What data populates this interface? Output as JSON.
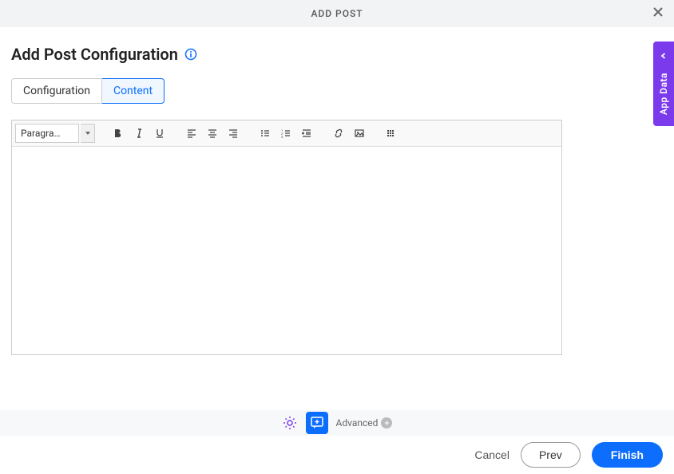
{
  "modal": {
    "title": "ADD POST"
  },
  "page": {
    "heading": "Add Post Configuration"
  },
  "tabs": {
    "configuration": "Configuration",
    "content": "Content"
  },
  "editor": {
    "format_label": "Paragra…"
  },
  "side_panel": {
    "label": "App Data"
  },
  "bottom": {
    "advanced": "Advanced"
  },
  "footer": {
    "cancel": "Cancel",
    "prev": "Prev",
    "finish": "Finish"
  }
}
